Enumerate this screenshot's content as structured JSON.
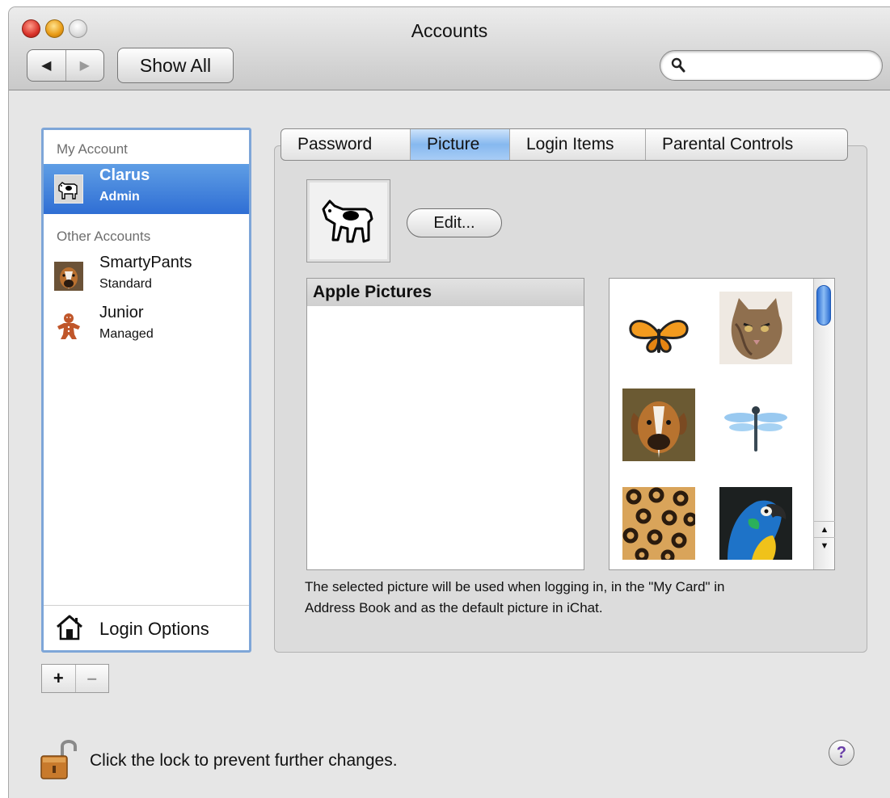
{
  "window": {
    "title": "Accounts"
  },
  "toolbar": {
    "back_glyph": "◀",
    "forward_glyph": "▶",
    "show_all_label": "Show All",
    "search_value": "",
    "search_placeholder": ""
  },
  "sidebar": {
    "my_account_header": "My Account",
    "my_account": {
      "name": "Clarus",
      "role": "Admin",
      "selected": true
    },
    "other_accounts_header": "Other Accounts",
    "other_accounts": [
      {
        "name": "SmartyPants",
        "role": "Standard"
      },
      {
        "name": "Junior",
        "role": "Managed"
      }
    ],
    "login_options_label": "Login Options",
    "add_glyph": "+",
    "remove_glyph": "–"
  },
  "tabs": [
    {
      "label": "Password",
      "active": false
    },
    {
      "label": "Picture",
      "active": true
    },
    {
      "label": "Login Items",
      "active": false
    },
    {
      "label": "Parental Controls",
      "active": false
    }
  ],
  "picture_pane": {
    "edit_button_label": "Edit...",
    "source_list_header": "Apple Pictures",
    "thumbnails": [
      "butterfly",
      "cat",
      "boxer-dog",
      "dragonfly",
      "leopard-fur",
      "parrot"
    ],
    "hint_text": "The selected picture will be used when logging in, in the \"My Card\" in Address Book and as the default picture in iChat."
  },
  "footer": {
    "lock_text": "Click the lock to prevent further changes.",
    "help_glyph": "?"
  },
  "colors": {
    "selection_blue": "#2f6ed4",
    "sidebar_focus_ring": "#7ea6d8",
    "tab_active": "#86b8ef"
  }
}
